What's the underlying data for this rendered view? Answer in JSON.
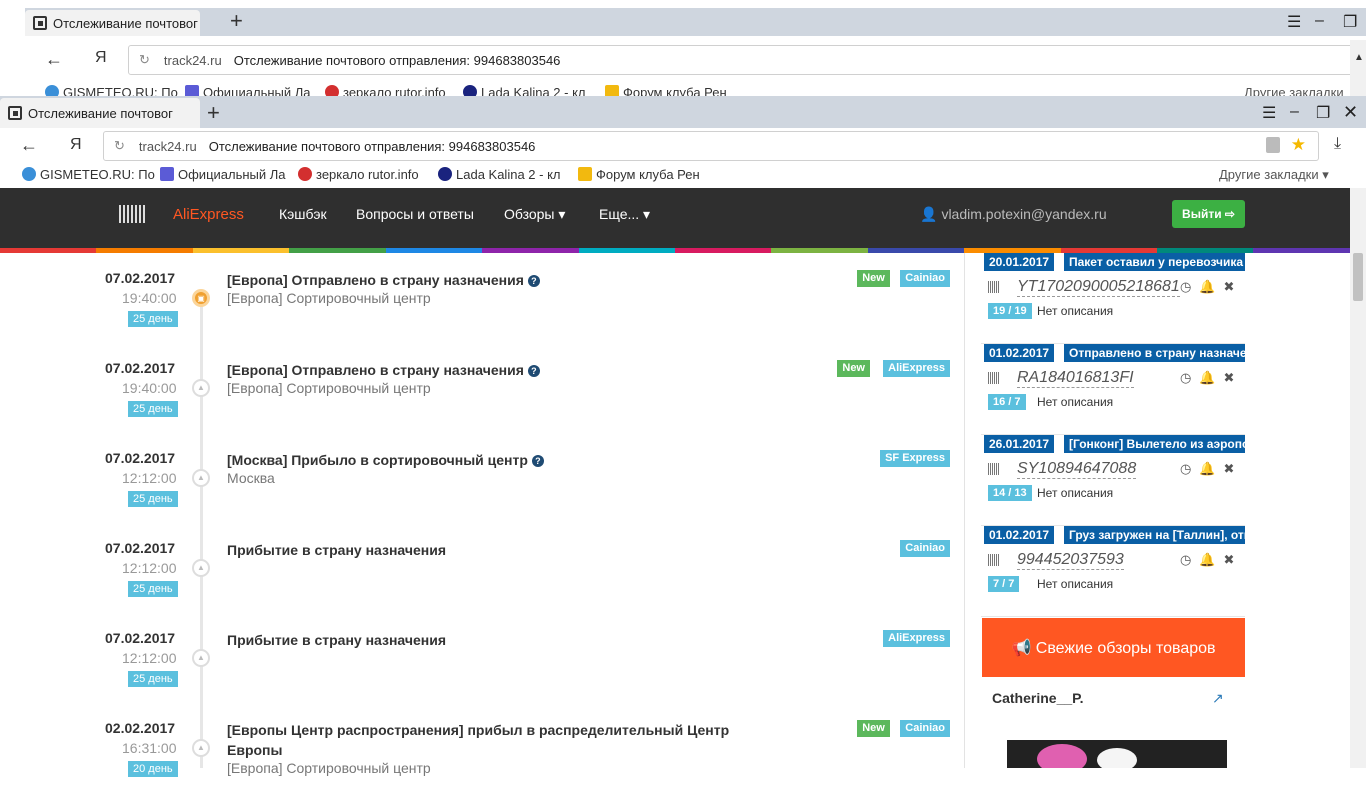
{
  "browser_back": {
    "tab_title": "Отслеживание почтовог",
    "host": "track24.ru",
    "page_title": "Отслеживание почтового отправления: 994683803546",
    "yandex_label": "Я",
    "bookmarks": [
      "GISMETEO.RU: По",
      "Официальный Ла",
      "зеркало rutor.info",
      "Lada Kalina 2 - кл",
      "Форум клуба Рен"
    ],
    "other_bookmarks": "Другие закладки"
  },
  "browser": {
    "tab_title": "Отслеживание почтовог",
    "host": "track24.ru",
    "page_title": "Отслеживание почтового отправления: 994683803546",
    "yandex_label": "Я",
    "bookmarks": [
      "GISMETEO.RU: По",
      "Официальный Ла",
      "зеркало rutor.info",
      "Lada Kalina 2 - кл",
      "Форум клуба Рен"
    ],
    "other_bookmarks": "Другие закладки ▾"
  },
  "nav": {
    "aliexpress": "AliExpress",
    "cashback": "Кэшбэк",
    "qa": "Вопросы и ответы",
    "reviews": "Обзоры ▾",
    "more": "Еще... ▾",
    "user": "vladim.potexin@yandex.ru",
    "logout": "Выйти ⇨"
  },
  "stripe_colors": [
    "#e53935",
    "#f57c00",
    "#fbc02d",
    "#43a047",
    "#1e88e5",
    "#8e24aa",
    "#00acc1",
    "#d81b60",
    "#7cb342",
    "#3949ab",
    "#fb8c00",
    "#e53935",
    "#00897b",
    "#5e35b1"
  ],
  "events": [
    {
      "date": "07.02.2017",
      "time": "19:40:00",
      "day": "25 день",
      "title": "[Европа] Отправлено в страну назначения",
      "help": true,
      "sub": "[Европа] Сортировочный центр",
      "badges": [
        {
          "text": "New",
          "type": "new"
        },
        {
          "text": "Cainiao",
          "type": "info"
        }
      ]
    },
    {
      "date": "07.02.2017",
      "time": "19:40:00",
      "day": "25 день",
      "title": "[Европа] Отправлено в страну назначения",
      "help": true,
      "sub": "[Европа] Сортировочный центр",
      "badges": [
        {
          "text": "New",
          "type": "new"
        },
        {
          "text": "AliExpress",
          "type": "info"
        }
      ]
    },
    {
      "date": "07.02.2017",
      "time": "12:12:00",
      "day": "25 день",
      "title": "[Москва] Прибыло в сортировочный центр",
      "help": true,
      "sub": "Москва",
      "badges": [
        {
          "text": "SF Express",
          "type": "info"
        }
      ]
    },
    {
      "date": "07.02.2017",
      "time": "12:12:00",
      "day": "25 день",
      "title": "Прибытие в страну назначения",
      "help": false,
      "sub": "",
      "badges": [
        {
          "text": "Cainiao",
          "type": "info"
        }
      ]
    },
    {
      "date": "07.02.2017",
      "time": "12:12:00",
      "day": "25 день",
      "title": "Прибытие в страну назначения",
      "help": false,
      "sub": "",
      "badges": [
        {
          "text": "AliExpress",
          "type": "info"
        }
      ]
    },
    {
      "date": "02.02.2017",
      "time": "16:31:00",
      "day": "20 день",
      "title": "[Европы Центр распространения] прибыл в распределительный Центр Европы",
      "help": false,
      "sub": "[Европа] Сортировочный центр",
      "badges": [
        {
          "text": "New",
          "type": "new"
        },
        {
          "text": "Cainiao",
          "type": "info"
        }
      ]
    }
  ],
  "tracks": [
    {
      "date": "20.01.2017",
      "status": "Пакет оставил у перевозчика",
      "number": "YT1702090005218681",
      "count": "19 / 19",
      "desc": "Нет описания"
    },
    {
      "date": "01.02.2017",
      "status": "Отправлено в страну назначения",
      "number": "RA184016813FI",
      "count": "16 / 7",
      "desc": "Нет описания"
    },
    {
      "date": "26.01.2017",
      "status": "[Гонконг] Вылетело из аэропорта",
      "number": "SY10894647088",
      "count": "14 / 13",
      "desc": "Нет описания"
    },
    {
      "date": "01.02.2017",
      "status": "Груз загружен на [Таллин], отправлен",
      "number": "994452037593",
      "count": "7 / 7",
      "desc": "Нет описания"
    }
  ],
  "sidebar": {
    "reviews_button": "📢 Свежие обзоры товаров",
    "author": "Catherine__P.",
    "external_icon": "external-link-icon"
  }
}
